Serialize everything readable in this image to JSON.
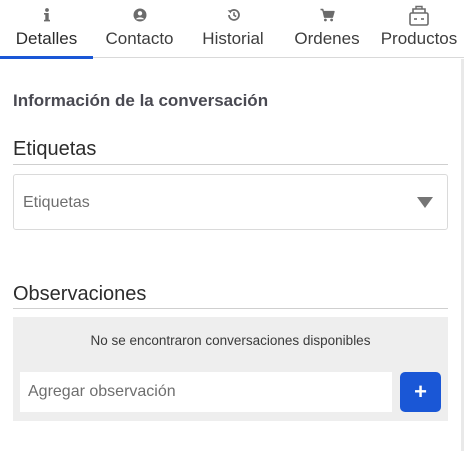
{
  "tabs": [
    {
      "label": "Detalles",
      "icon": "info-icon",
      "active": true
    },
    {
      "label": "Contacto",
      "icon": "user-icon",
      "active": false
    },
    {
      "label": "Historial",
      "icon": "history-icon",
      "active": false
    },
    {
      "label": "Ordenes",
      "icon": "cart-icon",
      "active": false
    },
    {
      "label": "Productos",
      "icon": "products-icon",
      "active": false
    }
  ],
  "conversation_info": {
    "title": "Información de la conversación"
  },
  "tags": {
    "heading": "Etiquetas",
    "placeholder": "Etiquetas"
  },
  "observations": {
    "heading": "Observaciones",
    "empty_message": "No se encontraron conversaciones disponibles",
    "input_placeholder": "Agregar observación",
    "add_label": "+"
  },
  "colors": {
    "accent": "#1a57d6",
    "panel_bg": "#eeeeee",
    "divider": "#cfcfcf"
  }
}
